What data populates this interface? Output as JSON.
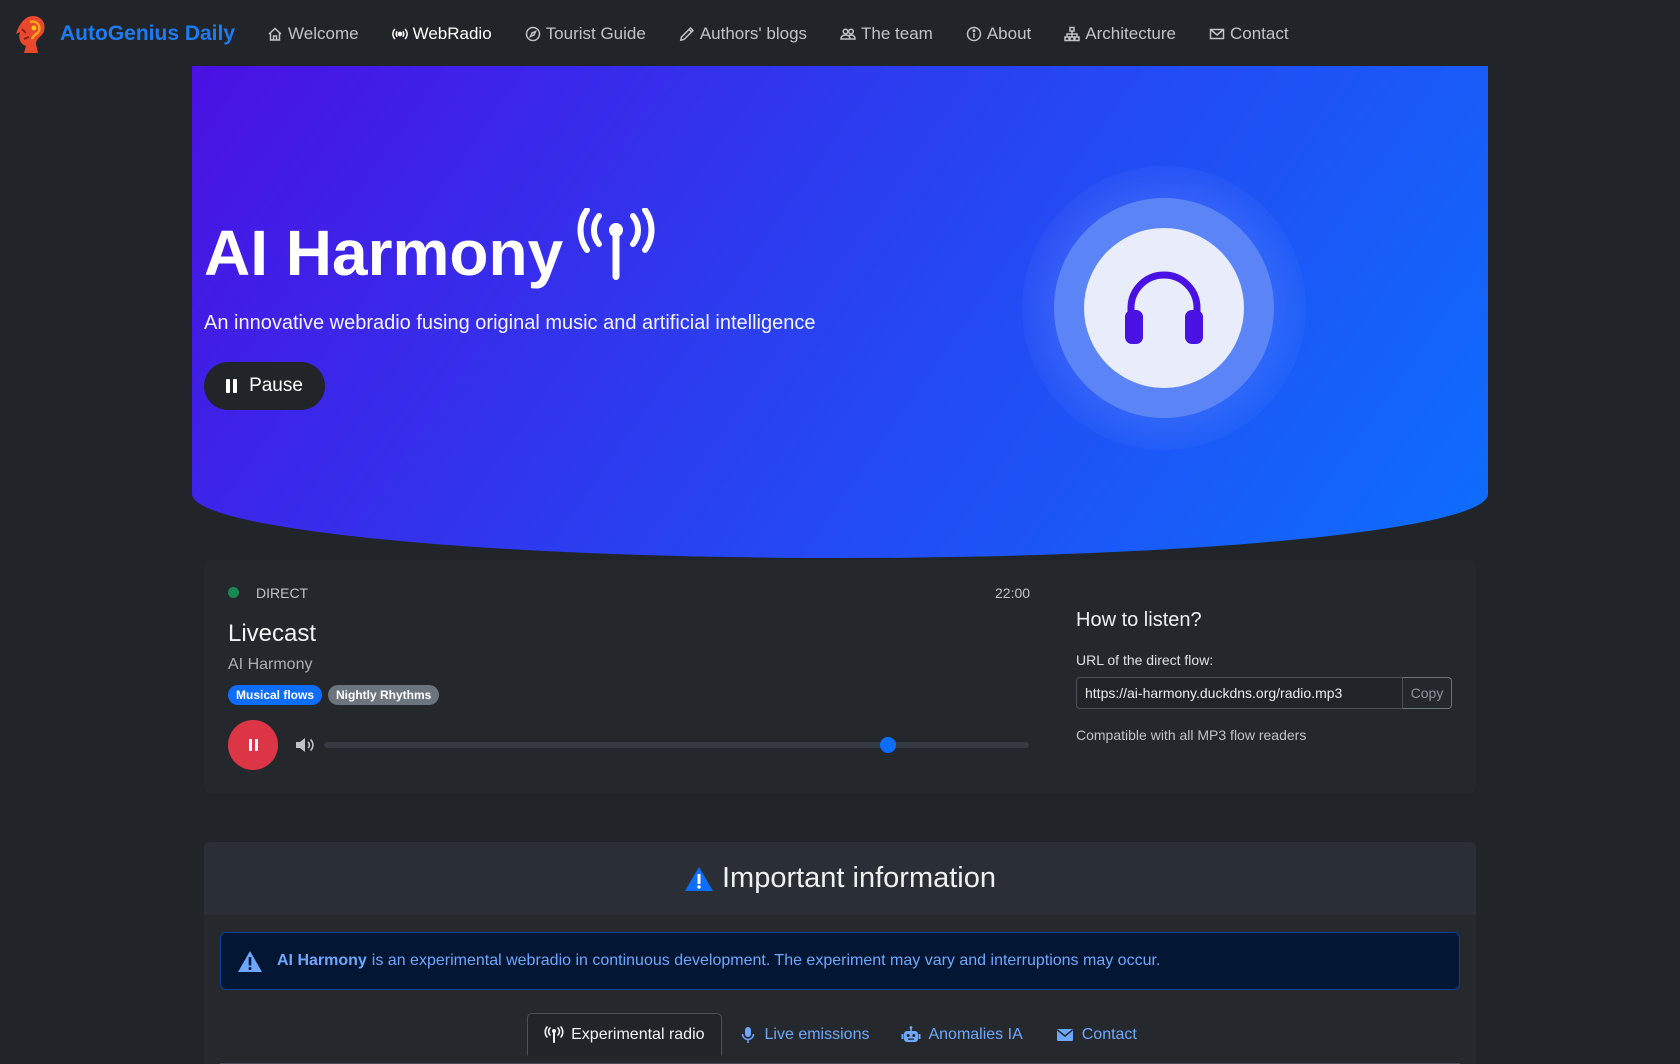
{
  "brand": {
    "name": "AutoGenius Daily"
  },
  "nav": [
    {
      "label": "Welcome",
      "icon": "house-icon"
    },
    {
      "label": "WebRadio",
      "icon": "broadcast-icon",
      "active": true
    },
    {
      "label": "Tourist Guide",
      "icon": "compass-icon"
    },
    {
      "label": "Authors' blogs",
      "icon": "pencil-icon"
    },
    {
      "label": "The team",
      "icon": "people-icon"
    },
    {
      "label": "About",
      "icon": "info-circle-icon"
    },
    {
      "label": "Architecture",
      "icon": "diagram-icon"
    },
    {
      "label": "Contact",
      "icon": "envelope-icon"
    }
  ],
  "hero": {
    "title": "AI Harmony",
    "subtitle": "An innovative webradio fusing original music and artificial intelligence",
    "button_label": "Pause",
    "gradient_start": "#4a11e3",
    "gradient_end": "#0d6efd",
    "icon": "headphones-icon"
  },
  "player": {
    "status": "DIRECT",
    "time": "22:00",
    "show_title": "Livecast",
    "artist": "AI Harmony",
    "tags": [
      "Musical flows",
      "Nightly Rhythms"
    ],
    "volume_fraction": 0.8,
    "listen": {
      "title": "How to listen?",
      "url_label": "URL of the direct flow:",
      "url": "https://ai-harmony.duckdns.org/radio.mp3",
      "copy_label": "Copy",
      "compat": "Compatible with all MP3 flow readers"
    }
  },
  "info": {
    "title": "Important information",
    "alert_bold": "AI Harmony",
    "alert_text": "is an experimental webradio in continuous development. The experiment may vary and interruptions may occur.",
    "tabs": [
      {
        "label": "Experimental radio",
        "icon": "broadcast-icon",
        "active": true
      },
      {
        "label": "Live emissions",
        "icon": "mic-icon"
      },
      {
        "label": "Anomalies IA",
        "icon": "robot-icon"
      },
      {
        "label": "Contact",
        "icon": "envelope-icon"
      }
    ]
  },
  "colors": {
    "accent": "#0d6efd",
    "live": "#198754",
    "play": "#dc3545",
    "background": "#212529"
  }
}
